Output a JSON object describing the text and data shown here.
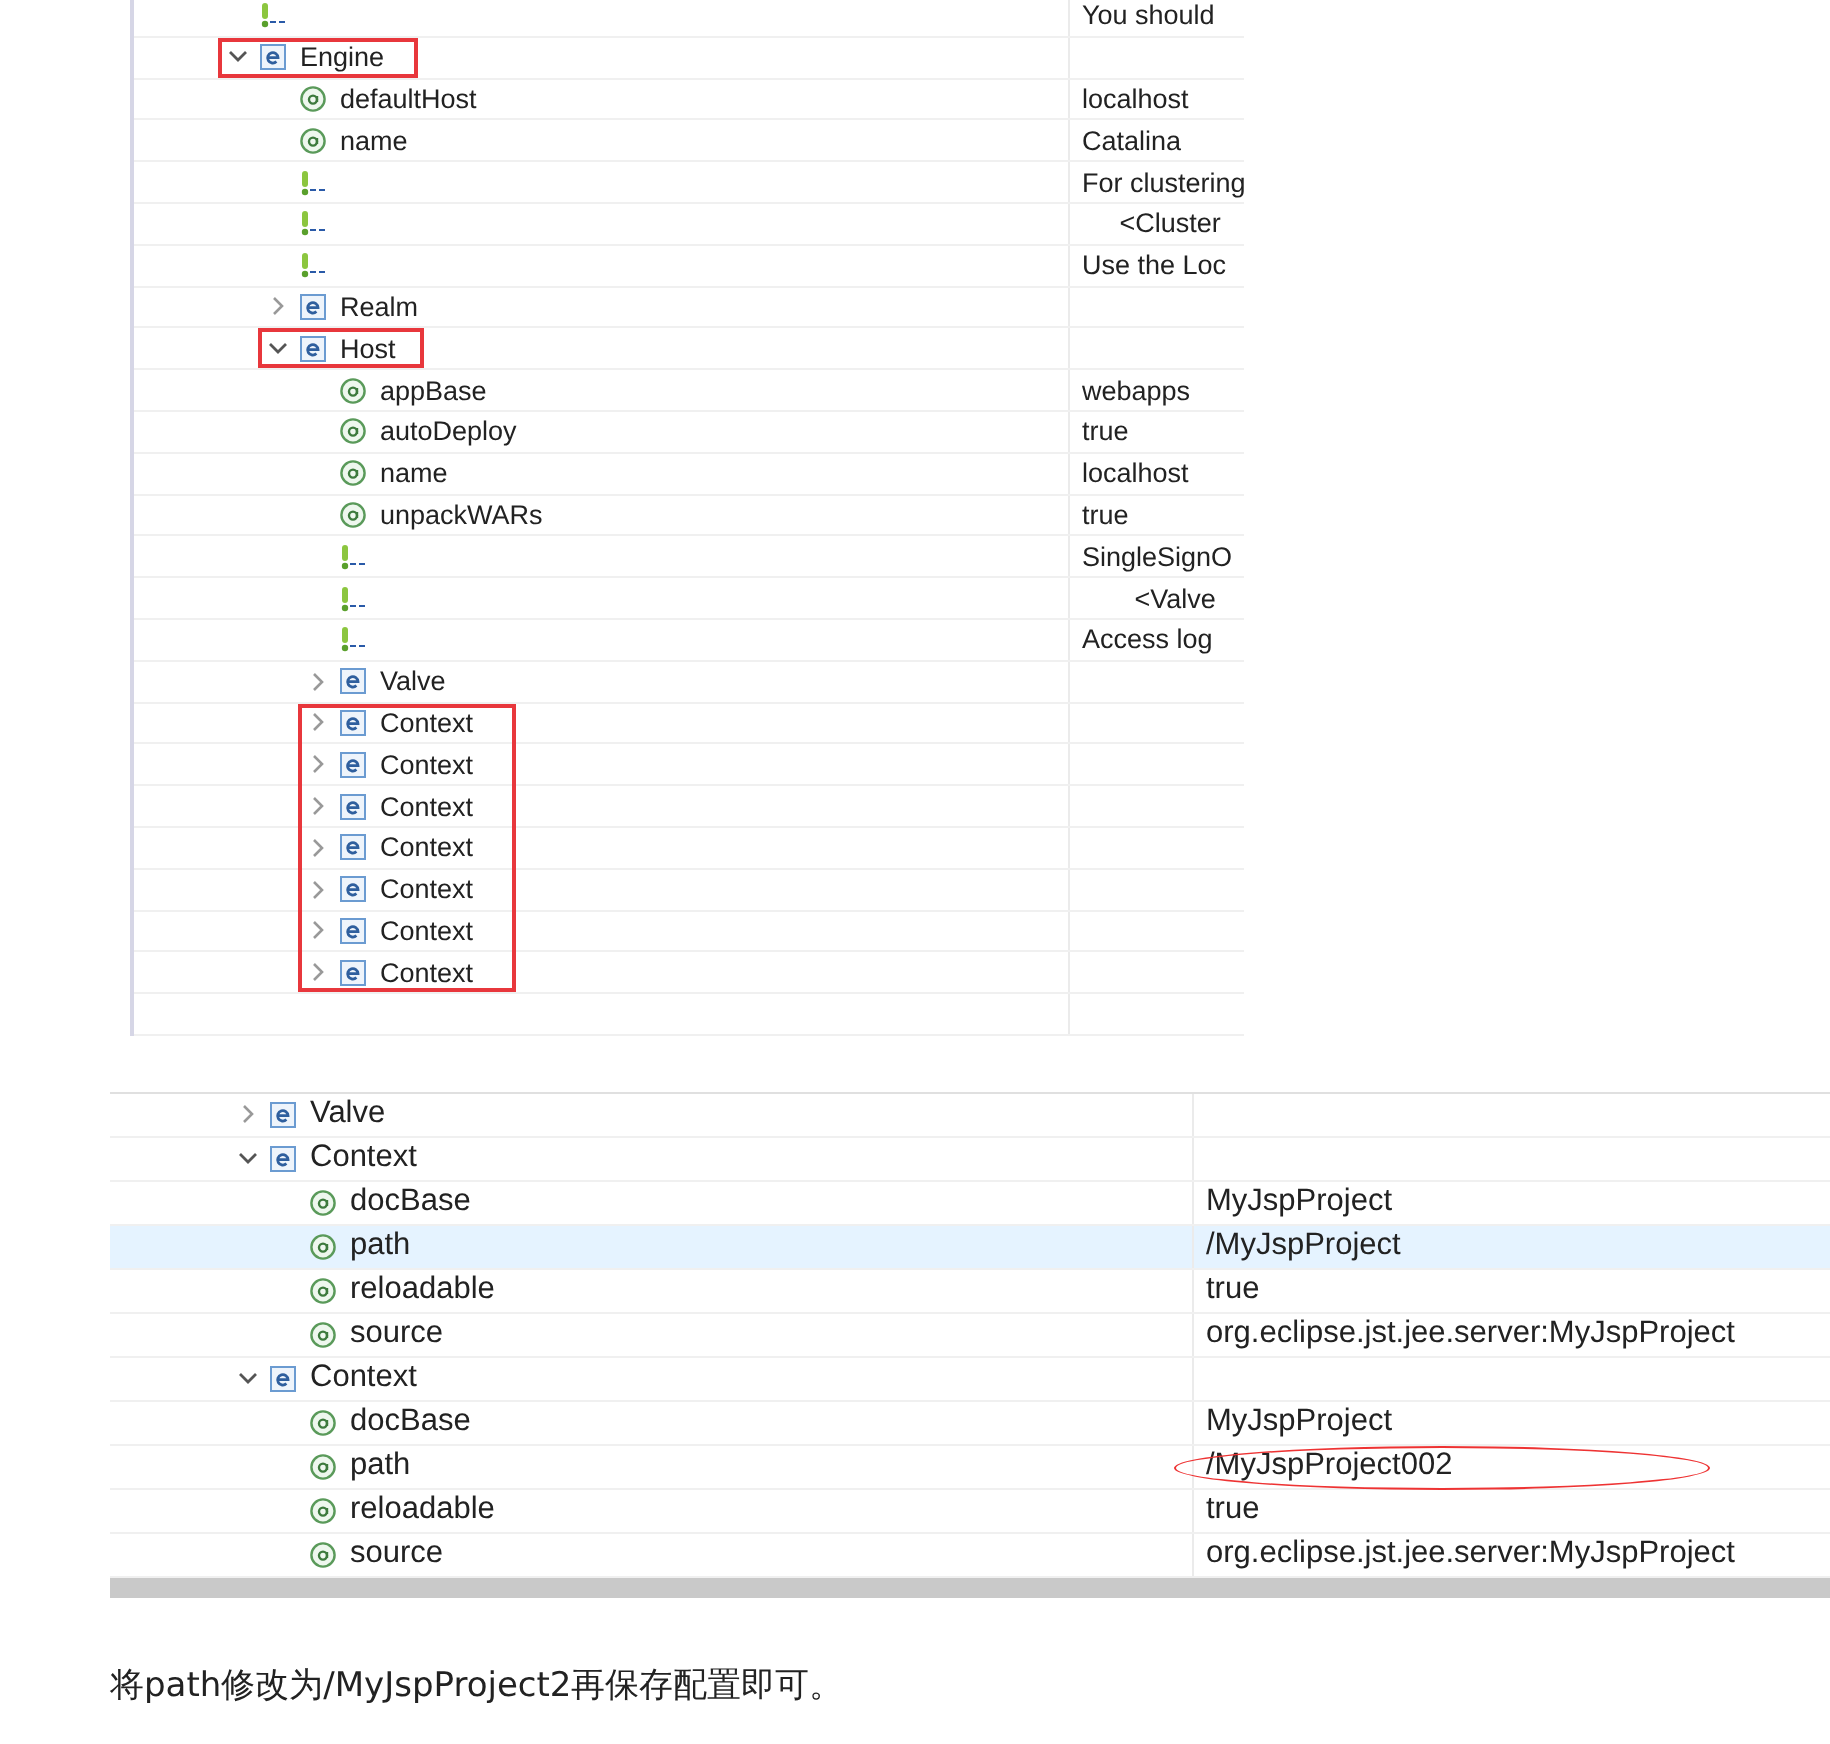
{
  "screens": [
    {
      "rows": [
        {
          "kind": "comment",
          "value": "You should"
        },
        {
          "kind": "element",
          "name": "Engine",
          "expanded": true,
          "boxed": true,
          "children": [
            {
              "kind": "attribute",
              "name": "defaultHost",
              "value": "localhost"
            },
            {
              "kind": "attribute",
              "name": "name",
              "value": "Catalina"
            },
            {
              "kind": "comment",
              "value": "For clustering"
            },
            {
              "kind": "comment",
              "value": "     <Cluster"
            },
            {
              "kind": "comment",
              "value": "Use the Loc"
            },
            {
              "kind": "element",
              "name": "Realm",
              "expanded": false,
              "boxed": false
            },
            {
              "kind": "element",
              "name": "Host",
              "expanded": true,
              "boxed": true,
              "children": [
                {
                  "kind": "attribute",
                  "name": "appBase",
                  "value": "webapps"
                },
                {
                  "kind": "attribute",
                  "name": "autoDeploy",
                  "value": "true"
                },
                {
                  "kind": "attribute",
                  "name": "name",
                  "value": "localhost"
                },
                {
                  "kind": "attribute",
                  "name": "unpackWARs",
                  "value": "true"
                },
                {
                  "kind": "comment",
                  "value": "SingleSignO"
                },
                {
                  "kind": "comment",
                  "value": "       <Valve"
                },
                {
                  "kind": "comment",
                  "value": "Access log"
                },
                {
                  "kind": "element",
                  "name": "Valve",
                  "expanded": false,
                  "boxed": false
                },
                {
                  "kind": "element",
                  "name": "Context",
                  "expanded": false,
                  "boxed": true
                },
                {
                  "kind": "element",
                  "name": "Context",
                  "expanded": false,
                  "boxed": true
                },
                {
                  "kind": "element",
                  "name": "Context",
                  "expanded": false,
                  "boxed": true
                },
                {
                  "kind": "element",
                  "name": "Context",
                  "expanded": false,
                  "boxed": true
                },
                {
                  "kind": "element",
                  "name": "Context",
                  "expanded": false,
                  "boxed": true
                },
                {
                  "kind": "element",
                  "name": "Context",
                  "expanded": false,
                  "boxed": true
                },
                {
                  "kind": "element",
                  "name": "Context",
                  "expanded": false,
                  "boxed": true
                }
              ]
            }
          ]
        }
      ]
    },
    {
      "rows": [
        {
          "kind": "element",
          "name": "Valve",
          "expanded": false,
          "selected": false
        },
        {
          "kind": "element",
          "name": "Context",
          "expanded": true,
          "selected": false,
          "children": [
            {
              "kind": "attribute",
              "name": "docBase",
              "value": "MyJspProject",
              "selected": false,
              "circled": false
            },
            {
              "kind": "attribute",
              "name": "path",
              "value": "/MyJspProject",
              "selected": true,
              "circled": false
            },
            {
              "kind": "attribute",
              "name": "reloadable",
              "value": "true",
              "selected": false,
              "circled": false
            },
            {
              "kind": "attribute",
              "name": "source",
              "value": "org.eclipse.jst.jee.server:MyJspProject",
              "selected": false,
              "circled": false
            }
          ]
        },
        {
          "kind": "element",
          "name": "Context",
          "expanded": true,
          "selected": false,
          "children": [
            {
              "kind": "attribute",
              "name": "docBase",
              "value": "MyJspProject",
              "selected": false,
              "circled": false
            },
            {
              "kind": "attribute",
              "name": "path",
              "value": "/MyJspProject002",
              "selected": false,
              "circled": true
            },
            {
              "kind": "attribute",
              "name": "reloadable",
              "value": "true",
              "selected": false,
              "circled": false
            },
            {
              "kind": "attribute",
              "name": "source",
              "value": "org.eclipse.jst.jee.server:MyJspProject",
              "selected": false,
              "circled": false
            }
          ]
        }
      ]
    }
  ],
  "caption": "将path修改为/MyJspProject2再保存配置即可。"
}
